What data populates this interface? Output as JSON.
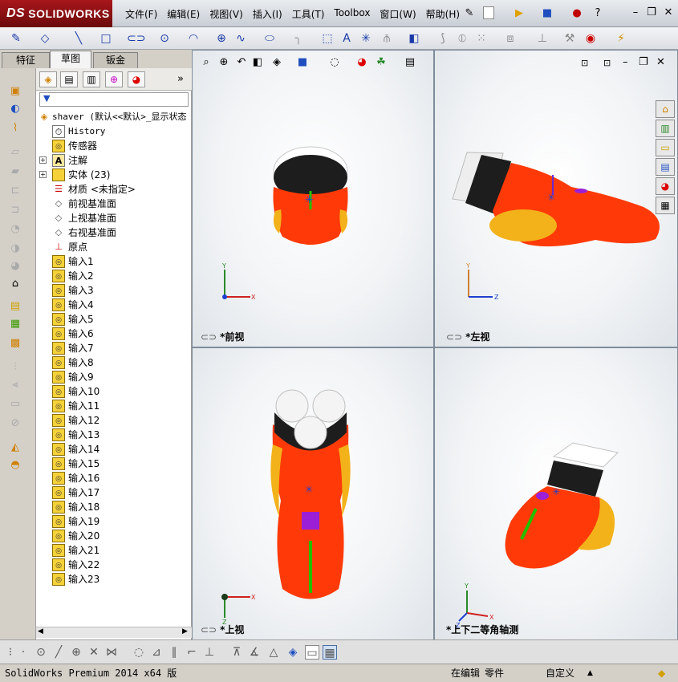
{
  "app": {
    "logo_ds": "DS",
    "logo_text": "SOLIDWORKS"
  },
  "menu": [
    "文件(F)",
    "编辑(E)",
    "视图(V)",
    "插入(I)",
    "工具(T)",
    "Toolbox",
    "窗口(W)",
    "帮助(H)"
  ],
  "tabs": [
    "特征",
    "草图",
    "钣金"
  ],
  "tree": {
    "root": "shaver  (默认<<默认>_显示状态",
    "history": "History",
    "sensors": "传感器",
    "annotations": "注解",
    "bodies": "实体 (23)",
    "material": "材质 <未指定>",
    "front_plane": "前视基准面",
    "top_plane": "上视基准面",
    "right_plane": "右视基准面",
    "origin": "原点",
    "imports": [
      "输入1",
      "输入2",
      "输入3",
      "输入4",
      "输入5",
      "输入6",
      "输入7",
      "输入8",
      "输入9",
      "输入10",
      "输入11",
      "输入12",
      "输入13",
      "输入14",
      "输入15",
      "输入16",
      "输入17",
      "输入18",
      "输入19",
      "输入20",
      "输入21",
      "输入22",
      "输入23"
    ]
  },
  "views": {
    "front": "*前视",
    "left": "*左视",
    "top": "*上视",
    "iso": "*上下二等角轴测"
  },
  "axes": {
    "x": "X",
    "y": "Y",
    "z": "Z"
  },
  "status": {
    "version": "SolidWorks Premium 2014 x64 版",
    "mode": "在编辑",
    "doc_type": "零件",
    "units": "自定义"
  },
  "colors": {
    "shaver_body": "#ff3a08",
    "grip": "#f3b21a",
    "head": "#222222",
    "accent": "#9b1fd6"
  }
}
